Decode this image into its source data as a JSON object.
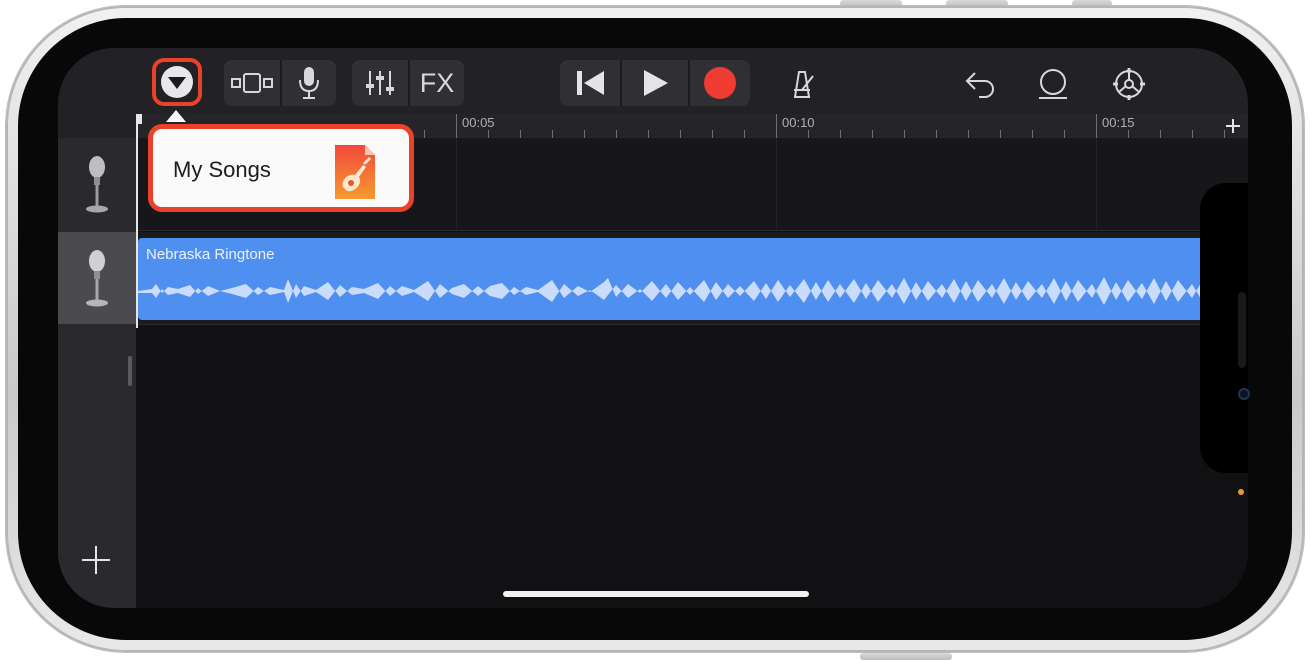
{
  "toolbar": {
    "fx_label": "FX"
  },
  "ruler": {
    "marks": [
      "00:05",
      "00:10",
      "00:15"
    ]
  },
  "popover": {
    "label": "My Songs"
  },
  "tracks": [
    {
      "type": "microphone",
      "region_title": ""
    },
    {
      "type": "microphone",
      "region_title": "Nebraska Ringtone"
    }
  ],
  "icons": {
    "menu": "chevron-down-icon",
    "browser": "track-view-icon",
    "mic": "microphone-icon",
    "mixer": "mixer-icon",
    "rewind": "go-to-beginning-icon",
    "play": "play-icon",
    "record": "record-icon",
    "metronome": "metronome-icon",
    "undo": "undo-icon",
    "loop": "loop-icon",
    "settings": "settings-icon",
    "add_track": "plus-icon",
    "add_section": "plus-icon"
  },
  "colors": {
    "highlight": "#e9412a",
    "region": "#4f8ff0",
    "record": "#ef3b32"
  }
}
